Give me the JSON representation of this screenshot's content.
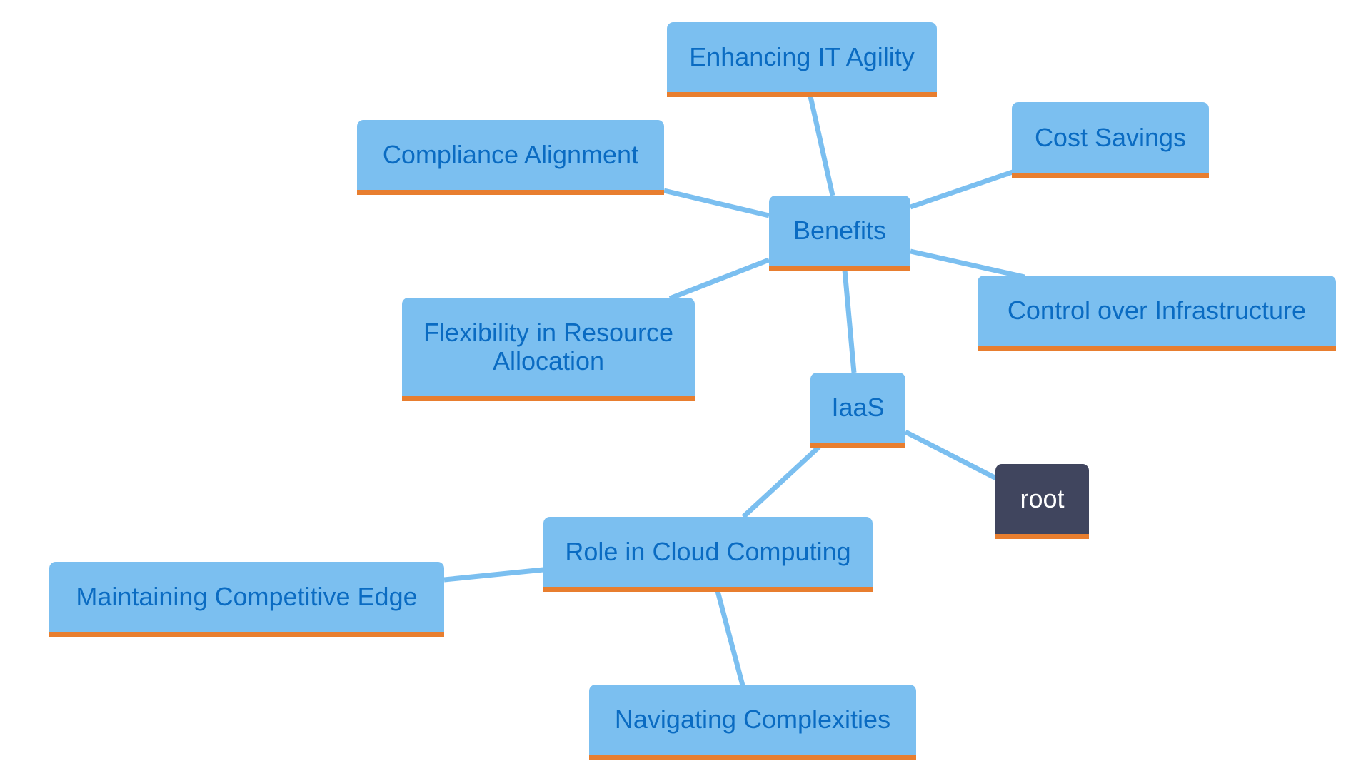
{
  "diagram": {
    "type": "mindmap",
    "colors": {
      "node_fill": "#7bbff0",
      "node_text": "#0a6bc2",
      "accent_underline": "#e87e2f",
      "link": "#7bbff0",
      "root_fill": "#40455e",
      "root_text": "#ffffff"
    },
    "nodes": {
      "root": "root",
      "iaas": "IaaS",
      "benefits": "Benefits",
      "role": "Role in Cloud Computing",
      "enhancing": "Enhancing IT Agility",
      "compliance": "Compliance Alignment",
      "cost": "Cost Savings",
      "control": "Control over Infrastructure",
      "flexibility": "Flexibility in Resource Allocation",
      "competitive": "Maintaining Competitive Edge",
      "navigating": "Navigating Complexities"
    },
    "edges": [
      [
        "root",
        "iaas"
      ],
      [
        "iaas",
        "benefits"
      ],
      [
        "iaas",
        "role"
      ],
      [
        "benefits",
        "enhancing"
      ],
      [
        "benefits",
        "compliance"
      ],
      [
        "benefits",
        "cost"
      ],
      [
        "benefits",
        "control"
      ],
      [
        "benefits",
        "flexibility"
      ],
      [
        "role",
        "competitive"
      ],
      [
        "role",
        "navigating"
      ]
    ]
  }
}
